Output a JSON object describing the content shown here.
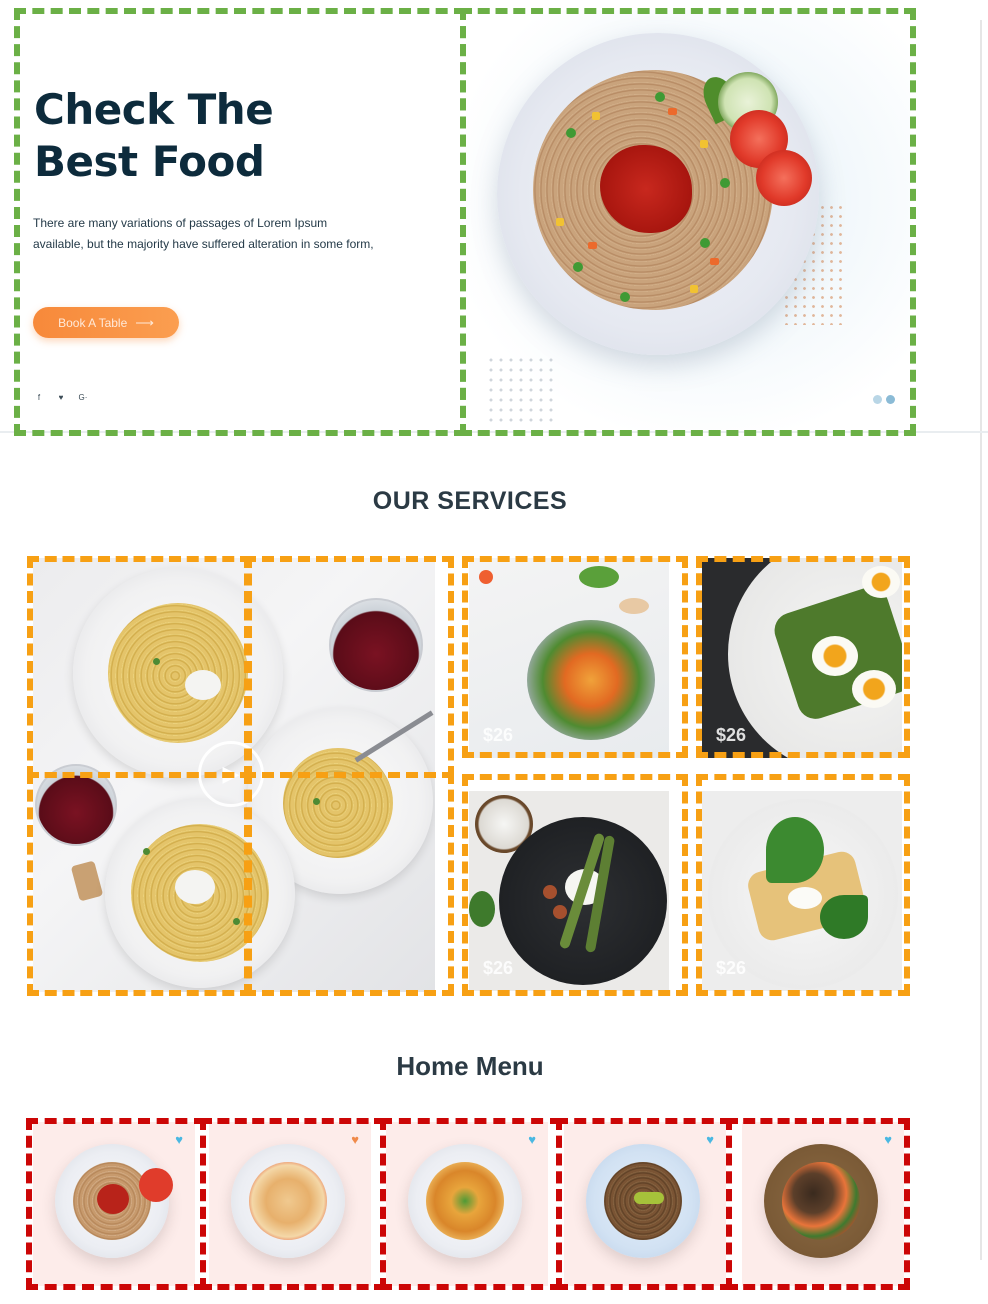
{
  "hero": {
    "title_line1": "Check The",
    "title_line2": "Best Food",
    "description": "There are many variations of passages of Lorem Ipsum available, but the majority have suffered alteration in some form,",
    "cta_label": "Book A Table",
    "cta_arrow": "⟶",
    "socials": [
      "f",
      "♥",
      "G·"
    ]
  },
  "services": {
    "title": "OUR SERVICES",
    "play_icon": "▶",
    "cards": [
      {
        "price": "$26"
      },
      {
        "price": "$26"
      },
      {
        "price": "$26"
      },
      {
        "price": "$26"
      }
    ]
  },
  "home_menu": {
    "title": "Home Menu",
    "heart_icon": "♥"
  },
  "colors": {
    "accent": "#f7893a",
    "heading": "#0d2b3c",
    "menu_card_bg": "#fdecea",
    "heart_blue": "#4ab8e2",
    "heart_orange": "#f08a4a"
  }
}
